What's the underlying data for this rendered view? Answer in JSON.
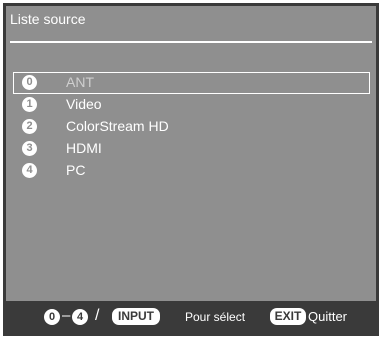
{
  "menu": {
    "title": "Liste source",
    "items": [
      {
        "num": "0",
        "label": "ANT"
      },
      {
        "num": "1",
        "label": "Video"
      },
      {
        "num": "2",
        "label": "ColorStream HD"
      },
      {
        "num": "3",
        "label": "HDMI"
      },
      {
        "num": "4",
        "label": "PC"
      }
    ],
    "selected_index": 0
  },
  "footer": {
    "range_from": "0",
    "range_sep": "–",
    "range_to": "4",
    "slash": "/",
    "input_key": "INPUT",
    "select_label": "Pour sélect",
    "exit_key": "EXIT",
    "exit_label": "Quitter"
  },
  "colors": {
    "panel": "#8f8f8f",
    "frame": "#3a3a3a",
    "text": "#ffffff",
    "selected_text": "#cfcfcf"
  }
}
